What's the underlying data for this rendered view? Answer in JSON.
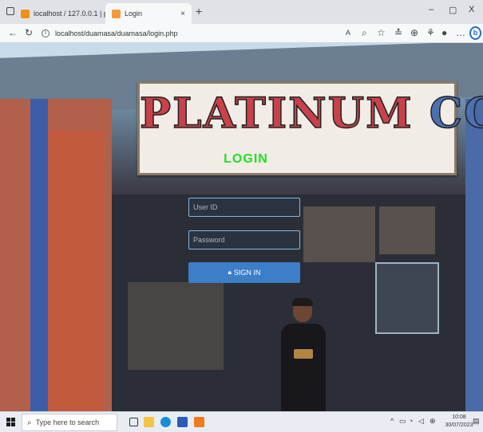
{
  "browser": {
    "tabs": [
      {
        "label": "localhost / 127.0.0.1 | phpMyAd",
        "favicon": "phpmyadmin-icon",
        "color": "#f29111"
      },
      {
        "label": "Login",
        "favicon": "login-page-icon",
        "color": "#f39a3b"
      }
    ],
    "new_tab_symbol": "+",
    "url": "localhost/duamasa/duamasa/login.php",
    "window_controls": [
      "–",
      "▢",
      "X"
    ]
  },
  "sign": {
    "word1": "PLATINUM",
    "word2": "COMPUTER"
  },
  "login": {
    "title": "LOGIN",
    "userid_placeholder": "User ID",
    "password_placeholder": "Password",
    "signin_label": "SIGN IN",
    "accent": "#3c7ec8",
    "title_color": "#20e020"
  },
  "taskbar": {
    "search_placeholder": "Type here to search",
    "time": "10:08",
    "date": "30/07/2023",
    "apps": [
      "task-view-icon",
      "file-explorer-icon",
      "edge-icon",
      "word-icon",
      "xampp-icon"
    ]
  }
}
